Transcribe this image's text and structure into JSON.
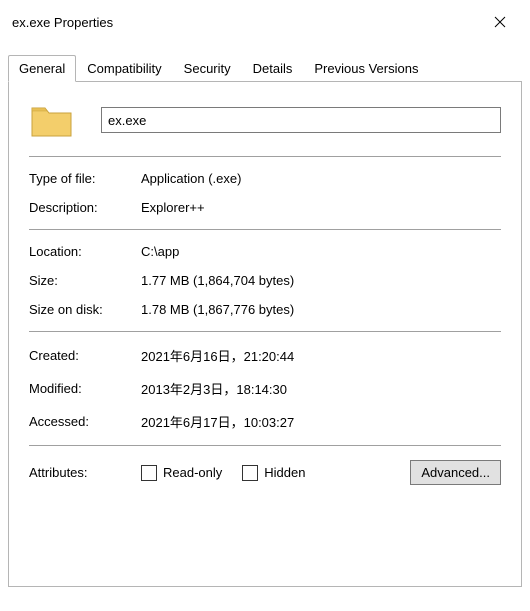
{
  "window": {
    "title": "ex.exe Properties"
  },
  "tabs": {
    "general": "General",
    "compatibility": "Compatibility",
    "security": "Security",
    "details": "Details",
    "previous": "Previous Versions"
  },
  "file": {
    "name": "ex.exe"
  },
  "labels": {
    "type": "Type of file:",
    "description": "Description:",
    "location": "Location:",
    "size": "Size:",
    "size_on_disk": "Size on disk:",
    "created": "Created:",
    "modified": "Modified:",
    "accessed": "Accessed:",
    "attributes": "Attributes:",
    "readonly": "Read-only",
    "hidden": "Hidden",
    "advanced": "Advanced..."
  },
  "values": {
    "type": "Application (.exe)",
    "description": "Explorer++",
    "location": "C:\\app",
    "size": "1.77 MB (1,864,704 bytes)",
    "size_on_disk": "1.78 MB (1,867,776 bytes)",
    "created": "2021年6月16日，21:20:44",
    "modified": "2013年2月3日，18:14:30",
    "accessed": "2021年6月17日，10:03:27"
  },
  "icons": {
    "folder_fill": "#f3ce6b",
    "folder_stroke": "#c9a23d"
  }
}
